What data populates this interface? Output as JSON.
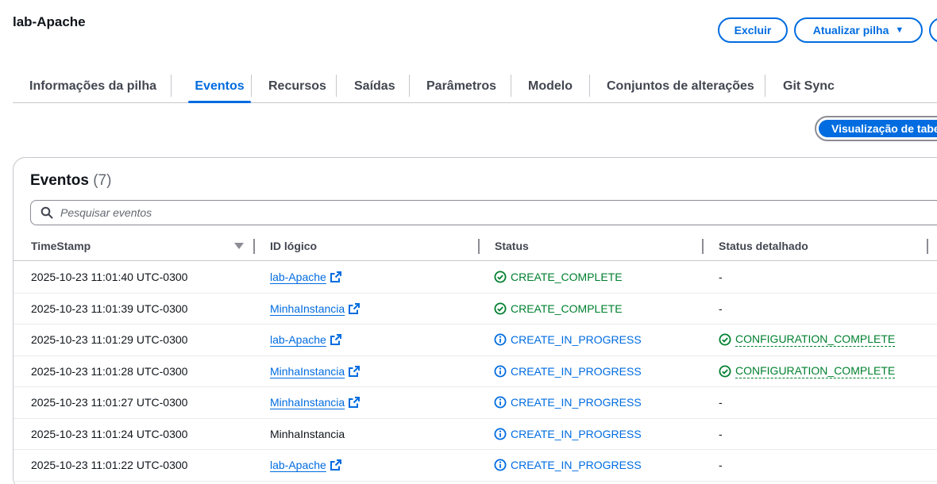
{
  "header": {
    "title": "lab-Apache",
    "delete_label": "Excluir",
    "update_label": "Atualizar pilha"
  },
  "tabs": [
    {
      "label": "Informações da pilha"
    },
    {
      "label": "Eventos"
    },
    {
      "label": "Recursos"
    },
    {
      "label": "Saídas"
    },
    {
      "label": "Parâmetros"
    },
    {
      "label": "Modelo"
    },
    {
      "label": "Conjuntos de alterações"
    },
    {
      "label": "Git Sync"
    }
  ],
  "active_tab": "Eventos",
  "view_toggle": {
    "label": "Visualização de tabela"
  },
  "events": {
    "heading": "Eventos",
    "count": "(7)",
    "search_placeholder": "Pesquisar eventos",
    "columns": {
      "timestamp": "TimeStamp",
      "logical_id": "ID lógico",
      "status": "Status",
      "status_detail": "Status detalhado"
    },
    "rows": [
      {
        "timestamp": "2025-10-23 11:01:40 UTC-0300",
        "logical_id": "lab-Apache",
        "status": "CREATE_COMPLETE",
        "detail": "-"
      },
      {
        "timestamp": "2025-10-23 11:01:39 UTC-0300",
        "logical_id": "MinhaInstancia",
        "status": "CREATE_COMPLETE",
        "detail": "-"
      },
      {
        "timestamp": "2025-10-23 11:01:29 UTC-0300",
        "logical_id": "lab-Apache",
        "status": "CREATE_IN_PROGRESS",
        "detail": "CONFIGURATION_COMPLETE"
      },
      {
        "timestamp": "2025-10-23 11:01:28 UTC-0300",
        "logical_id": "MinhaInstancia",
        "status": "CREATE_IN_PROGRESS",
        "detail": "CONFIGURATION_COMPLETE"
      },
      {
        "timestamp": "2025-10-23 11:01:27 UTC-0300",
        "logical_id": "MinhaInstancia",
        "status": "CREATE_IN_PROGRESS",
        "detail": "-"
      },
      {
        "timestamp": "2025-10-23 11:01:24 UTC-0300",
        "logical_id": "MinhaInstancia",
        "status": "CREATE_IN_PROGRESS",
        "detail": "-"
      },
      {
        "timestamp": "2025-10-23 11:01:22 UTC-0300",
        "logical_id": "lab-Apache",
        "status": "CREATE_IN_PROGRESS",
        "detail": "-"
      }
    ]
  },
  "colors": {
    "accent": "#006ce0",
    "success": "#00802f",
    "border": "#c6c6cd"
  }
}
